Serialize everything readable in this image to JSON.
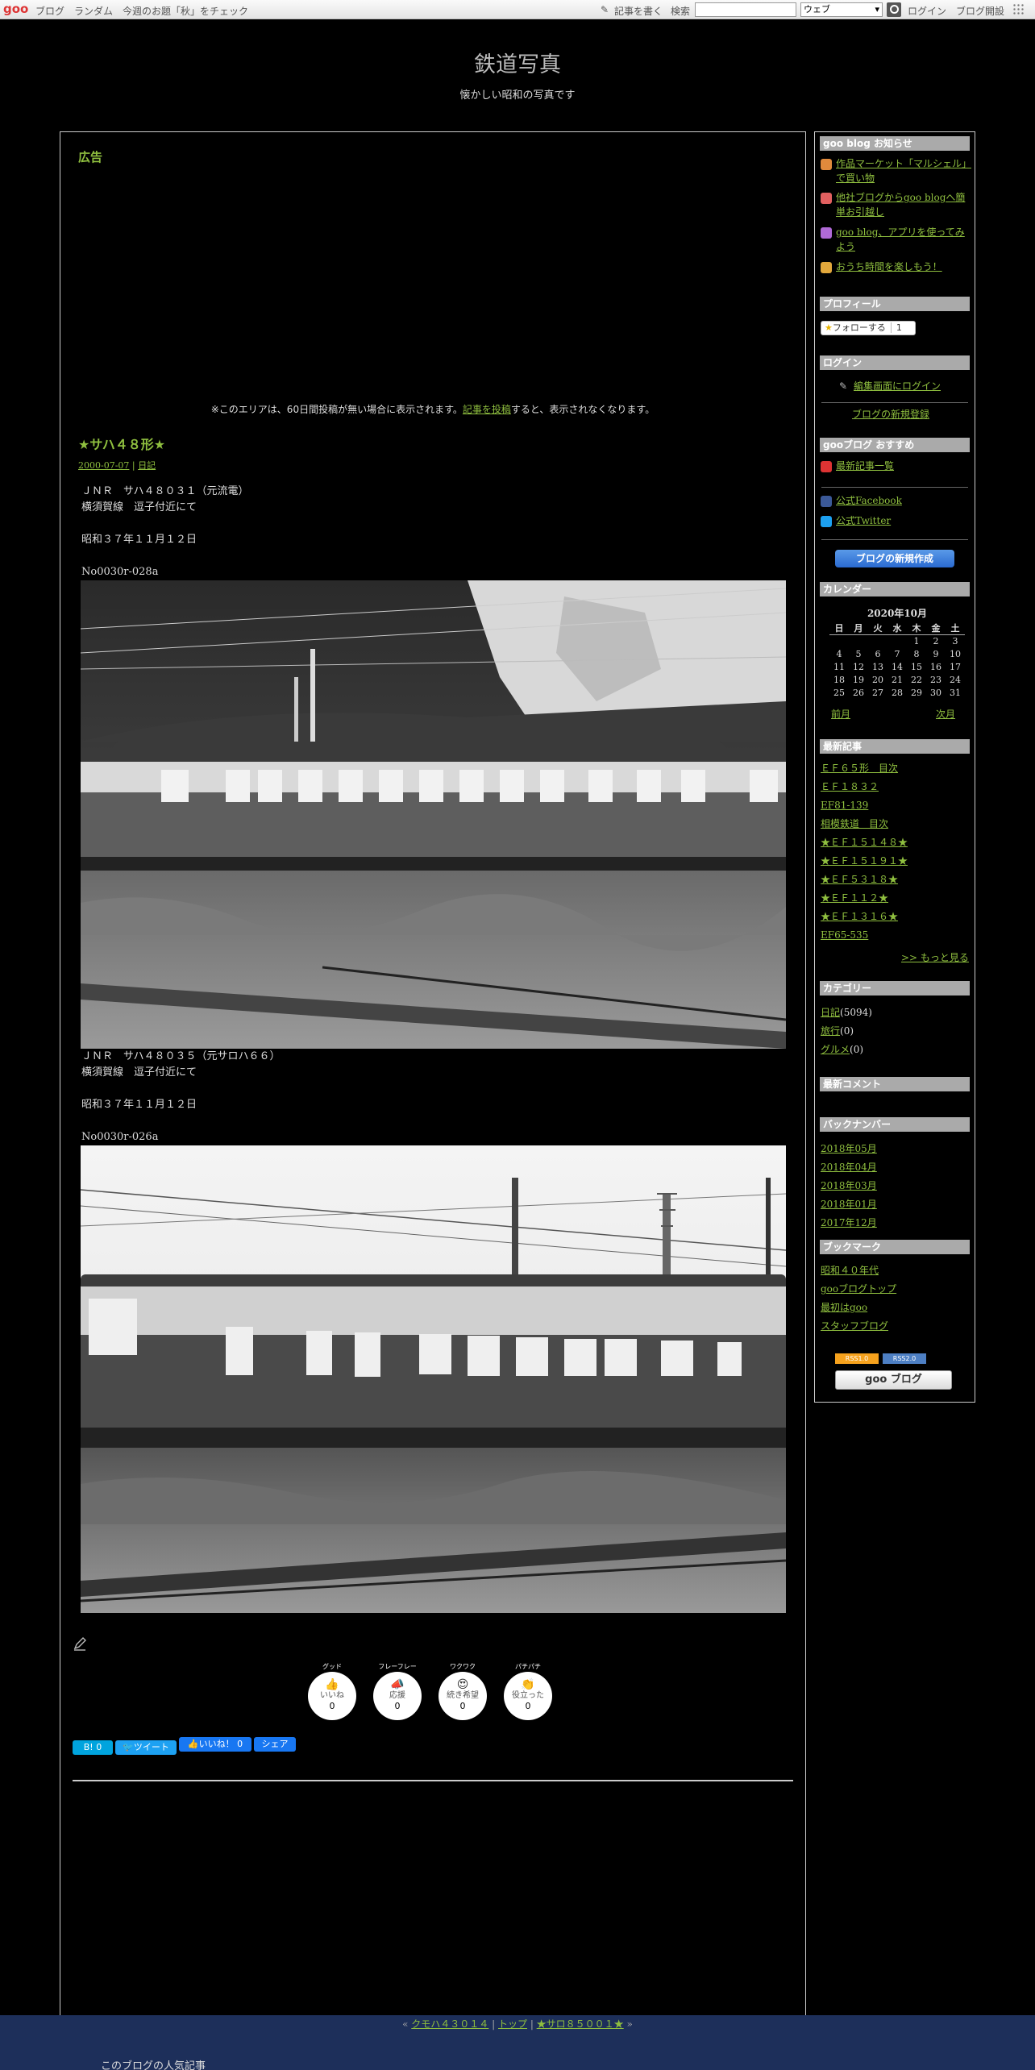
{
  "topbar": {
    "logo": "goo",
    "links": [
      "ブログ",
      "ランダム",
      "今週のお題「秋」をチェック"
    ],
    "write": "記事を書く",
    "search_label": "検索",
    "search_scope": "ウェブ",
    "login": "ログイン",
    "open_blog": "ブログ開設"
  },
  "header": {
    "title": "鉄道写真",
    "description": "懐かしい昭和の写真です"
  },
  "ad": {
    "title": "広告",
    "note_prefix": "※このエリアは、60日間投稿が無い場合に表示されます。",
    "note_link": "記事を投稿",
    "note_suffix": "すると、表示されなくなります。"
  },
  "entry": {
    "title": "★サハ４８形★",
    "date": "2000-07-07",
    "category": "日記",
    "block1": "ＪＮＲ　サハ４８０３１（元流電）\n横須賀線　逗子付近にて\n\n昭和３７年１１月１２日\n\nNo0030r-028a",
    "block2": "ＪＮＲ　サハ４８０３５（元サロハ６６）\n横須賀線　逗子付近にて\n\n昭和３７年１１月１２日\n\nNo0030r-026a"
  },
  "reactions": [
    {
      "kana": "グッド",
      "label": "いいね",
      "count": "0",
      "emoji": "👍"
    },
    {
      "kana": "フレーフレー",
      "label": "応援",
      "count": "0",
      "emoji": "📣"
    },
    {
      "kana": "ワクワク",
      "label": "続き希望",
      "count": "0",
      "emoji": "😍"
    },
    {
      "kana": "パチパチ",
      "label": "役立った",
      "count": "0",
      "emoji": "👏"
    }
  ],
  "share": {
    "hatena": "B! 0",
    "tweet": "ツイート",
    "fb_like": "いいね！ 0",
    "fb_share": "シェア"
  },
  "sidebar": {
    "notice_head": "goo blog お知らせ",
    "notices": [
      "作品マーケット「マルシェル」で買い物",
      "他社ブログからgoo blogへ簡単お引越し",
      "goo blog、アプリを使ってみよう",
      "おうち時間を楽しもう！"
    ],
    "profile_head": "プロフィール",
    "follow": "フォローする",
    "follow_count": "1",
    "login_head": "ログイン",
    "login_link": "編集画面にログイン",
    "register_link": "ブログの新規登録",
    "recommend_head": "gooブログ おすすめ",
    "recommend_latest": "最新記事一覧",
    "facebook": "公式Facebook",
    "twitter": "公式Twitter",
    "create_button": "ブログの新規作成",
    "calendar_head": "カレンダー",
    "calendar_title": "2020年10月",
    "weekdays": [
      "日",
      "月",
      "火",
      "水",
      "木",
      "金",
      "土"
    ],
    "weeks": [
      [
        "",
        "",
        "",
        "",
        "1",
        "2",
        "3"
      ],
      [
        "4",
        "5",
        "6",
        "7",
        "8",
        "9",
        "10"
      ],
      [
        "11",
        "12",
        "13",
        "14",
        "15",
        "16",
        "17"
      ],
      [
        "18",
        "19",
        "20",
        "21",
        "22",
        "23",
        "24"
      ],
      [
        "25",
        "26",
        "27",
        "28",
        "29",
        "30",
        "31"
      ]
    ],
    "prev_month": "前月",
    "next_month": "次月",
    "recent_head": "最新記事",
    "recent": [
      "ＥＦ６５形　目次",
      "ＥＦ１８３２",
      "EF81-139",
      "相模鉄道　目次",
      "★ＥＦ１５１４８★",
      "★ＥＦ１５１９１★",
      "★ＥＦ５３１８★",
      "★ＥＦ１１２★",
      "★ＥＦ１３１６★",
      "EF65-535"
    ],
    "more": ">> もっと見る",
    "category_head": "カテゴリー",
    "categories": [
      {
        "name": "日記",
        "count": "(5094)"
      },
      {
        "name": "旅行",
        "count": "(0)"
      },
      {
        "name": "グルメ",
        "count": "(0)"
      }
    ],
    "comments_head": "最新コメント",
    "backnumber_head": "バックナンバー",
    "backnumbers": [
      "2018年05月",
      "2018年04月",
      "2018年03月",
      "2018年01月",
      "2017年12月"
    ],
    "bookmark_head": "ブックマーク",
    "bookmarks": [
      "昭和４０年代",
      "gooブログトップ",
      "最初はgoo",
      "スタッフブログ"
    ],
    "badge_rss1": "RSS1.0",
    "badge_rss2": "RSS2.0",
    "goo_badge": "goo ブログ"
  },
  "footer": {
    "prev": "クモハ４３０１４",
    "top": "トップ",
    "next": "★サロ８５００１★",
    "popular": "このブログの人気記事"
  },
  "colors": {
    "link": "#8fbf3f",
    "footer_bg": "#1d2f5a",
    "sidebar_head_bg": "#aaaaaa"
  }
}
